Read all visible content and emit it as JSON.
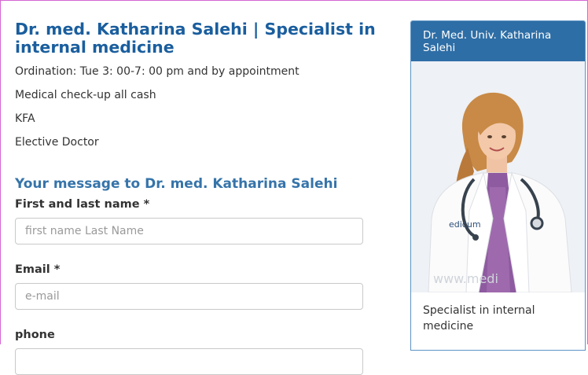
{
  "page": {
    "title": "Dr. med. Katharina Salehi | Specialist in internal medicine",
    "info_lines": [
      "Ordination: Tue 3: 00-7: 00 pm and by appointment",
      "Medical check-up all cash",
      "KFA",
      "Elective Doctor"
    ]
  },
  "contact_form": {
    "heading": "Your message to Dr. med. Katharina Salehi",
    "name_label": "First and last name *",
    "name_placeholder": "first name Last Name",
    "email_label": "Email *",
    "email_placeholder": "e-mail",
    "phone_label": "phone"
  },
  "sidebar": {
    "header": "Dr. Med. Univ. Katharina Salehi",
    "caption": "Specialist in internal medicine",
    "photo_watermark": "www.medi",
    "coat_logo_text": "edicum"
  },
  "colors": {
    "title": "#1a5e9e",
    "section_heading": "#3674aa",
    "card_header_bg": "#2e6ea6",
    "card_border": "#5d93c4"
  }
}
